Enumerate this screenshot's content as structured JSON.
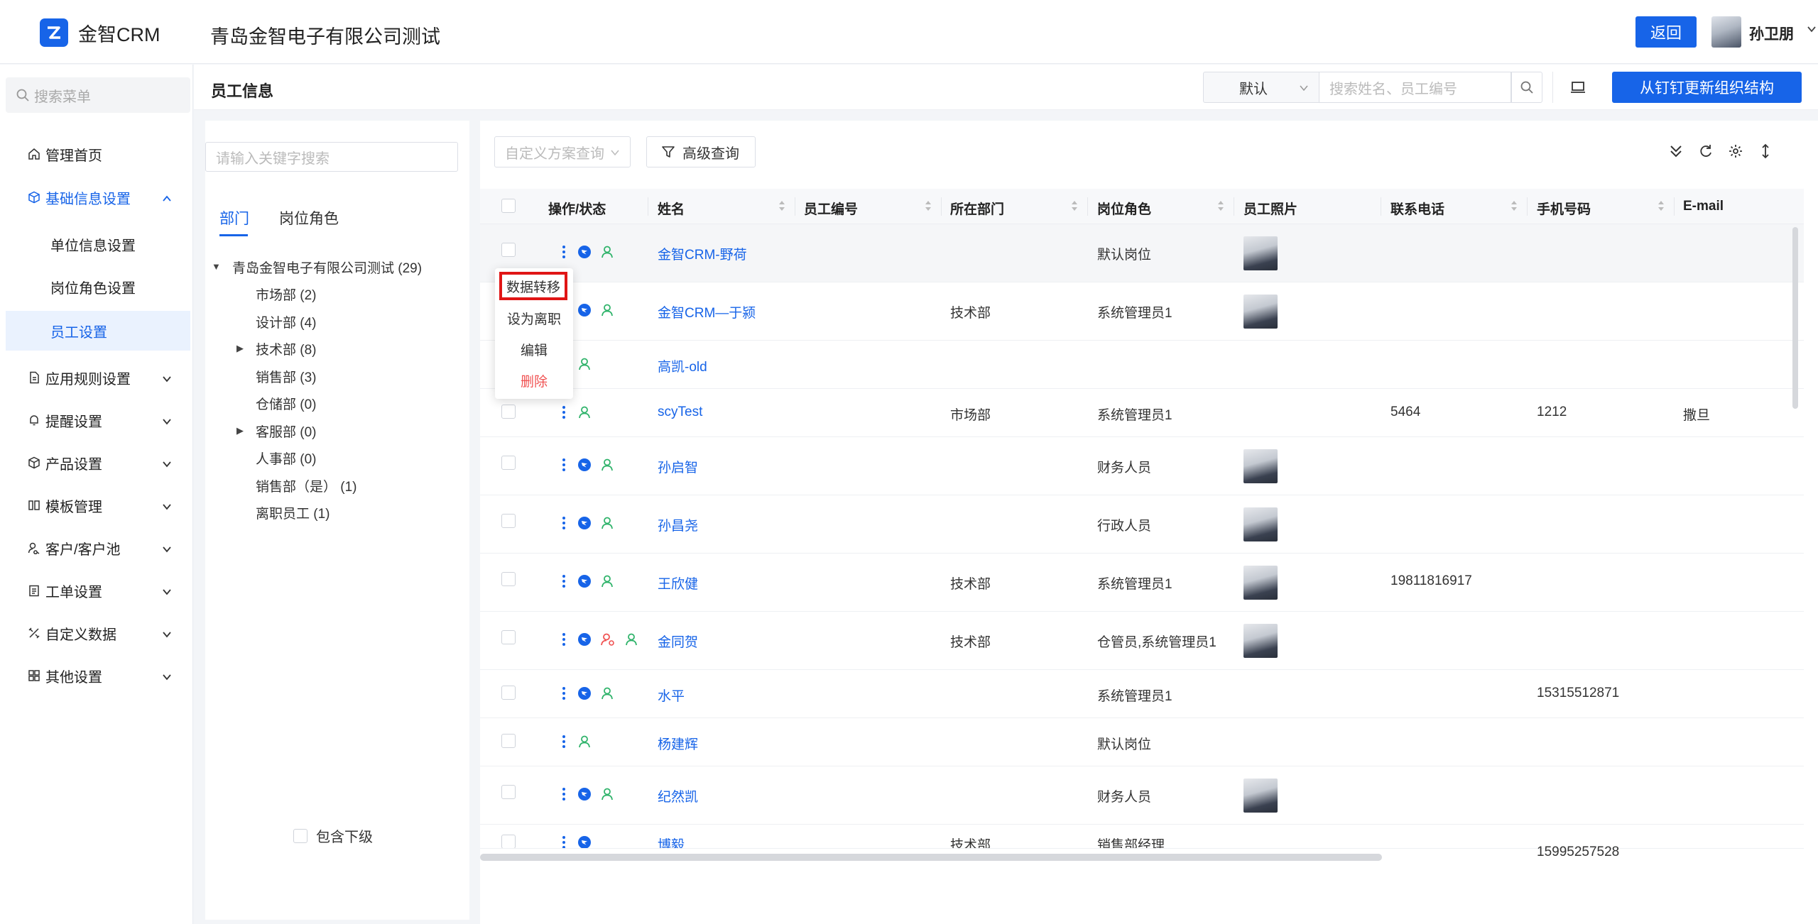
{
  "header": {
    "app_name": "金智CRM",
    "company": "青岛金智电子有限公司测试",
    "back_label": "返回",
    "user_name": "孙卫朋"
  },
  "sidebar": {
    "search_placeholder": "搜索菜单",
    "home": "管理首页",
    "basic": "基础信息设置",
    "sub": [
      "单位信息设置",
      "岗位角色设置",
      "员工设置"
    ],
    "menus": [
      "应用规则设置",
      "提醒设置",
      "产品设置",
      "模板管理",
      "客户/客户池",
      "工单设置",
      "自定义数据",
      "其他设置"
    ]
  },
  "page": {
    "title": "员工信息",
    "scheme": "默认",
    "search_placeholder": "搜索姓名、员工编号",
    "sync_label": "从钉钉更新组织结构"
  },
  "tree": {
    "search_placeholder": "请输入关键字搜索",
    "tabs": [
      "部门",
      "岗位角色"
    ],
    "root": "青岛金智电子有限公司测试 (29)",
    "nodes": [
      "市场部 (2)",
      "设计部 (4)",
      "技术部 (8)",
      "销售部 (3)",
      "仓储部 (0)",
      "客服部 (0)",
      "人事部 (0)",
      "销售部（是） (1)",
      "离职员工 (1)"
    ],
    "include_sub": "包含下级"
  },
  "toolbar": {
    "custom_query": "自定义方案查询",
    "advanced_query": "高级查询"
  },
  "table": {
    "headers": [
      "操作/状态",
      "姓名",
      "员工编号",
      "所在部门",
      "岗位角色",
      "员工照片",
      "联系电话",
      "手机号码",
      "E-mail"
    ],
    "rows": [
      {
        "name": "金智CRM-野荷",
        "dept": "",
        "role": "默认岗位",
        "phone": "",
        "mobile": "",
        "email": ""
      },
      {
        "name": "金智CRM—于颍",
        "dept": "技术部",
        "role": "系统管理员1",
        "phone": "",
        "mobile": "",
        "email": ""
      },
      {
        "name": "高凯-old",
        "dept": "",
        "role": "",
        "phone": "",
        "mobile": "",
        "email": ""
      },
      {
        "name": "scyTest",
        "dept": "市场部",
        "role": "系统管理员1",
        "phone": "5464",
        "mobile": "1212",
        "email": "撒旦"
      },
      {
        "name": "孙启智",
        "dept": "",
        "role": "财务人员",
        "phone": "",
        "mobile": "",
        "email": ""
      },
      {
        "name": "孙昌尧",
        "dept": "",
        "role": "行政人员",
        "phone": "",
        "mobile": "",
        "email": ""
      },
      {
        "name": "王欣健",
        "dept": "技术部",
        "role": "系统管理员1",
        "phone": "19811816917",
        "mobile": "",
        "email": ""
      },
      {
        "name": "金同贺",
        "dept": "技术部",
        "role": "仓管员,系统管理员1",
        "phone": "",
        "mobile": "",
        "email": ""
      },
      {
        "name": "水平",
        "dept": "",
        "role": "系统管理员1",
        "phone": "",
        "mobile": "15315512871",
        "email": ""
      },
      {
        "name": "杨建辉",
        "dept": "",
        "role": "默认岗位",
        "phone": "",
        "mobile": "",
        "email": ""
      },
      {
        "name": "纪然凯",
        "dept": "",
        "role": "财务人员",
        "phone": "",
        "mobile": "",
        "email": ""
      },
      {
        "name": "博毅",
        "dept": "技术部",
        "role": "销售部经理",
        "phone": "",
        "mobile": "15995257528",
        "email": ""
      }
    ]
  },
  "dropdown": {
    "items": [
      "数据转移",
      "设为离职",
      "编辑",
      "删除"
    ]
  },
  "colors": {
    "primary": "#1764e8",
    "danger": "#f05252",
    "highlight_box": "#e01515",
    "status_green": "#2fb36a"
  }
}
